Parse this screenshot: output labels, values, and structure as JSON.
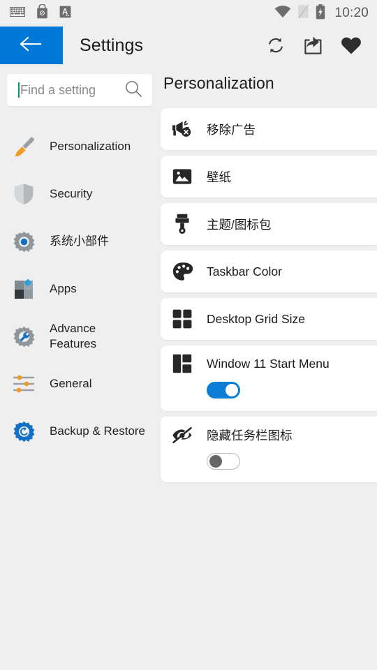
{
  "statusbar": {
    "time": "10:20",
    "left_icons": [
      "keyboard-icon",
      "lock-bag-icon",
      "letter-a-badge-icon"
    ],
    "right_icons": [
      "wifi-icon",
      "no-sim-icon",
      "battery-charging-icon"
    ]
  },
  "appbar": {
    "title": "Settings",
    "back_icon": "arrow-left-icon",
    "back_color": "#0078d7",
    "actions": [
      {
        "name": "refresh-icon",
        "label": "Refresh"
      },
      {
        "name": "share-icon",
        "label": "Share"
      },
      {
        "name": "heart-icon",
        "label": "Favorite"
      }
    ]
  },
  "search": {
    "value": "",
    "placeholder": "Find a setting",
    "icon": "search-icon",
    "caret_color": "#0f9080"
  },
  "sidebar": {
    "items": [
      {
        "label": "Personalization",
        "icon": "paintbrush-icon"
      },
      {
        "label": "Security",
        "icon": "shield-icon"
      },
      {
        "label": "系统小部件",
        "icon": "gear-icon"
      },
      {
        "label": "Apps",
        "icon": "apps-squares-icon"
      },
      {
        "label": "Advance\nFeatures",
        "icon": "gear-wrench-icon"
      },
      {
        "label": "General",
        "icon": "sliders-icon"
      },
      {
        "label": "Backup & Restore",
        "icon": "backup-restore-icon"
      }
    ]
  },
  "main": {
    "title": "Personalization",
    "items": [
      {
        "label": "移除广告",
        "icon": "megaphone-off-icon",
        "type": "link"
      },
      {
        "label": "壁纸",
        "icon": "image-icon",
        "type": "link"
      },
      {
        "label": "主题/图标包",
        "icon": "brush-icon",
        "type": "link"
      },
      {
        "label": "Taskbar Color",
        "icon": "palette-icon",
        "type": "link"
      },
      {
        "label": "Desktop Grid Size",
        "icon": "grid-icon",
        "type": "link"
      },
      {
        "label": "Window 11 Start Menu",
        "icon": "start-menu-icon",
        "type": "toggle",
        "toggle_state": "on"
      },
      {
        "label": "隐藏任务栏图标",
        "icon": "eye-off-icon",
        "type": "toggle",
        "toggle_state": "off"
      }
    ]
  },
  "colors": {
    "accent": "#0078d7",
    "toggle_on": "#0b7dd4",
    "page_bg": "#efefef",
    "card_bg": "#ffffff"
  }
}
